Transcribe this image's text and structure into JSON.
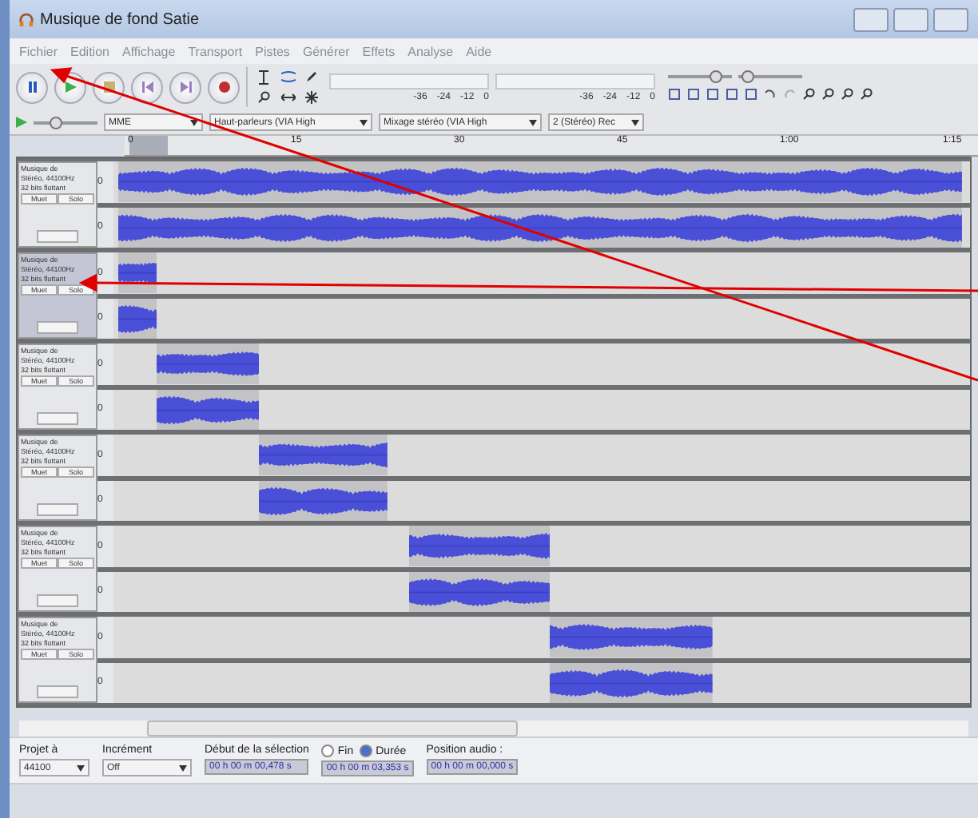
{
  "window": {
    "title": "Musique de fond Satie"
  },
  "menu": [
    "Fichier",
    "Edition",
    "Affichage",
    "Transport",
    "Pistes",
    "Générer",
    "Effets",
    "Analyse",
    "Aide"
  ],
  "meter_scales": [
    [
      "-36",
      "-24",
      "-12",
      "0"
    ],
    [
      "-36",
      "-24",
      "-12",
      "0"
    ]
  ],
  "sliders": {
    "playback": {
      "level": 0.75
    },
    "recording": {
      "level": 0.15
    },
    "play_speed": {
      "level": 0.35
    }
  },
  "devices": {
    "host": "MME",
    "output": "Haut-parleurs (VIA High",
    "input": "Mixage stéréo (VIA High",
    "channels": "2 (Stéréo) Rec"
  },
  "ruler": [
    "0",
    "15",
    "30",
    "45",
    "1:00",
    "1:15"
  ],
  "tracks": [
    {
      "name": "Musique de",
      "format": "Stéréo, 44100Hz",
      "bits": "32 bits flottant",
      "mute": "Muet",
      "solo": "Solo",
      "selected": false,
      "channels": [
        "0",
        "0"
      ]
    },
    {
      "name": "Musique de",
      "format": "Stéréo, 44100Hz",
      "bits": "32 bits flottant",
      "mute": "Muet",
      "solo": "Solo",
      "selected": true,
      "channels": [
        "0",
        "0"
      ]
    },
    {
      "name": "Musique de",
      "format": "Stéréo, 44100Hz",
      "bits": "32 bits flottant",
      "mute": "Muet",
      "solo": "Solo",
      "selected": false,
      "channels": [
        "0",
        "0"
      ]
    },
    {
      "name": "Musique de",
      "format": "Stéréo, 44100Hz",
      "bits": "32 bits flottant",
      "mute": "Muet",
      "solo": "Solo",
      "selected": false,
      "channels": [
        "0",
        "0"
      ]
    },
    {
      "name": "Musique de",
      "format": "Stéréo, 44100Hz",
      "bits": "32 bits flottant",
      "mute": "Muet",
      "solo": "Solo",
      "selected": false,
      "channels": [
        "0",
        "0"
      ]
    },
    {
      "name": "Musique de",
      "format": "Stéréo, 44100Hz",
      "bits": "32 bits flottant",
      "mute": "Muet",
      "solo": "Solo",
      "selected": false,
      "channels": [
        "0",
        "0"
      ]
    }
  ],
  "selection_bar": {
    "rate_label": "Projet à",
    "rate": "44100",
    "snap_label": "Incrément",
    "snap": "Off",
    "start_label": "Début de la sélection",
    "end_options": [
      {
        "label": "Fin",
        "selected": false
      },
      {
        "label": "Durée",
        "selected": true
      }
    ],
    "start": "00 h 00 m 00,478 s",
    "end": "00 h 00 m 03,353 s",
    "position_label": "Position audio :",
    "position": "00 h 00 m 00,000 s"
  }
}
